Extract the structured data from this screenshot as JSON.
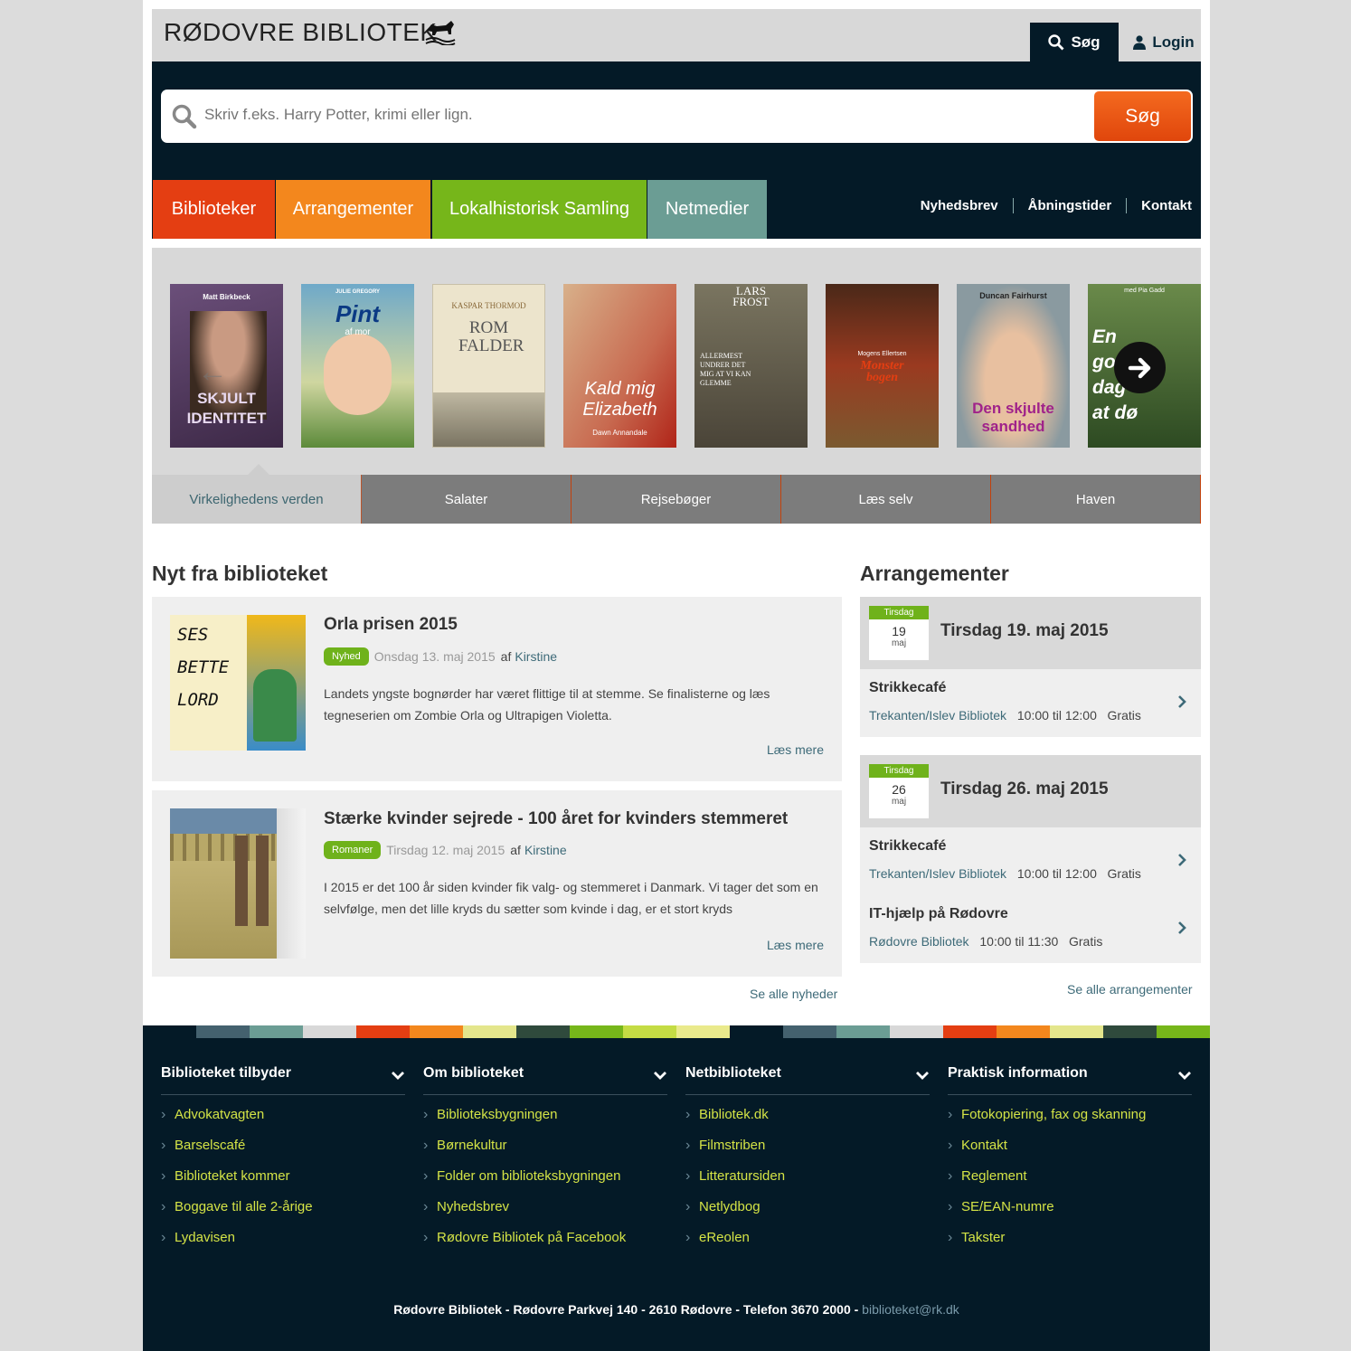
{
  "header": {
    "logo_text": "RØDOVRE BIBLIOTEK",
    "search_label": "Søg",
    "login_label": "Login"
  },
  "search": {
    "placeholder": "Skriv f.eks. Harry Potter, krimi eller lign.",
    "button": "Søg"
  },
  "nav": {
    "tabs": [
      {
        "label": "Biblioteker",
        "color": "#e43e12"
      },
      {
        "label": "Arrangementer",
        "color": "#f3871d"
      },
      {
        "label": "Lokalhistorisk Samling",
        "color": "#76b61a"
      },
      {
        "label": "Netmedier",
        "color": "#6b9d94"
      }
    ],
    "links": [
      "Nyhedsbrev",
      "Åbningstider",
      "Kontakt"
    ]
  },
  "carousel": {
    "covers": [
      {
        "author": "Matt Birkbeck",
        "title": "SKJULT IDENTITET"
      },
      {
        "author": "JULIE GREGORY",
        "title": "Pint",
        "subtitle": "af mor"
      },
      {
        "author": "KASPAR THORMOD",
        "title": "ROM FALDER"
      },
      {
        "author": "Dawn Annandale",
        "title": "Kald mig Elizabeth"
      },
      {
        "author": "LARS FROST",
        "title": "ALLERMEST UNDRER DET MIG AT VI KAN GLEMME"
      },
      {
        "author": "Mogens Ellertsen",
        "title": "Monster bogen"
      },
      {
        "author": "Duncan Fairhurst",
        "title": "Den skjulte sandhed"
      },
      {
        "author": "med Pia Gadd",
        "title": "En god dag at dø"
      }
    ],
    "categories": [
      "Virkelighedens verden",
      "Salater",
      "Rejsebøger",
      "Læs selv",
      "Haven"
    ]
  },
  "news": {
    "heading": "Nyt fra biblioteket",
    "items": [
      {
        "title": "Orla prisen 2015",
        "tag": "Nyhed",
        "date": "Onsdag 13. maj 2015",
        "by": "af",
        "author": "Kirstine",
        "text": "Landets yngste bognørder har været flittige til at stemme. Se finalisterne og læs tegneserien om Zombie Orla og Ultrapigen Violetta.",
        "more": "Læs mere",
        "thumb_text": [
          "SES",
          "BETTE",
          "LORD"
        ]
      },
      {
        "title": "Stærke kvinder sejrede - 100 året for kvinders stemmeret",
        "tag": "Romaner",
        "date": "Tirsdag 12. maj 2015",
        "by": "af",
        "author": "Kirstine",
        "text": "I 2015 er det 100 år siden kvinder fik valg- og stemmeret i Danmark. Vi tager det som en selvfølge, men det lille kryds du sætter som kvinde i dag, er et stort kryds",
        "more": "Læs mere"
      }
    ],
    "see_all": "Se alle nyheder"
  },
  "events": {
    "heading": "Arrangementer",
    "days": [
      {
        "dow": "Tirsdag",
        "day": "19",
        "month": "maj",
        "title": "Tirsdag 19. maj 2015",
        "events": [
          {
            "name": "Strikkecafé",
            "location": "Trekanten/Islev Bibliotek",
            "time": "10:00 til 12:00",
            "price": "Gratis"
          }
        ]
      },
      {
        "dow": "Tirsdag",
        "day": "26",
        "month": "maj",
        "title": "Tirsdag 26. maj 2015",
        "events": [
          {
            "name": "Strikkecafé",
            "location": "Trekanten/Islev Bibliotek",
            "time": "10:00 til 12:00",
            "price": "Gratis"
          },
          {
            "name": "IT-hjælp på Rødovre",
            "location": "Rødovre Bibliotek",
            "time": "10:00 til 11:30",
            "price": "Gratis"
          }
        ]
      }
    ],
    "see_all": "Se alle arrangementer"
  },
  "stripe_colors": [
    "#041a27",
    "#44616e",
    "#6b9d94",
    "#d8d8d8",
    "#e43e12",
    "#f3871d",
    "#e4e68c",
    "#2f4a3c",
    "#76b61a",
    "#c4dc44",
    "#eaea8c",
    "#041a27",
    "#44616e",
    "#6b9d94",
    "#d8d8d8",
    "#e43e12",
    "#f3871d",
    "#e4e68c",
    "#2f4a3c",
    "#76b61a"
  ],
  "footer": {
    "columns": [
      {
        "heading": "Biblioteket tilbyder",
        "items": [
          "Advokatvagten",
          "Barselscafé",
          "Biblioteket kommer",
          "Boggave til alle 2-årige",
          "Lydavisen"
        ]
      },
      {
        "heading": "Om biblioteket",
        "items": [
          "Biblioteksbygningen",
          "Børnekultur",
          "Folder om biblioteksbygningen",
          "Nyhedsbrev",
          "Rødovre Bibliotek på Facebook"
        ]
      },
      {
        "heading": "Netbiblioteket",
        "items": [
          "Bibliotek.dk",
          "Filmstriben",
          "Litteratursiden",
          "Netlydbog",
          "eReolen"
        ]
      },
      {
        "heading": "Praktisk information",
        "items": [
          "Fotokopiering, fax og skanning",
          "Kontakt",
          "Reglement",
          "SE/EAN-numre",
          "Takster"
        ]
      }
    ],
    "address": "Rødovre Bibliotek - Rødovre Parkvej 140 - 2610 Rødovre - Telefon 3670 2000 -",
    "email": "biblioteket@rk.dk"
  }
}
